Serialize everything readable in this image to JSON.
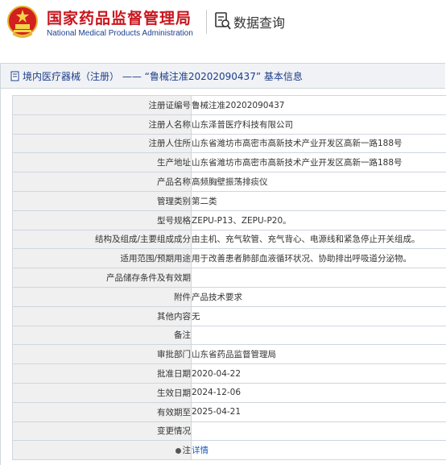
{
  "header": {
    "brand_cn": "国家药品监督管理局",
    "brand_en": "National Medical Products Administration",
    "page_title": "数据查询"
  },
  "panel": {
    "title": "境内医疗器械（注册） —— “鲁械注准20202090437” 基本信息"
  },
  "rows": [
    {
      "label": "注册证编号",
      "value": "鲁械注准20202090437"
    },
    {
      "label": "注册人名称",
      "value": "山东泽普医疗科技有限公司"
    },
    {
      "label": "注册人住所",
      "value": "山东省潍坊市高密市高新技术产业开发区高新一路188号"
    },
    {
      "label": "生产地址",
      "value": "山东省潍坊市高密市高新技术产业开发区高新一路188号"
    },
    {
      "label": "产品名称",
      "value": "高频胸壁振荡排痰仪"
    },
    {
      "label": "管理类别",
      "value": "第二类"
    },
    {
      "label": "型号规格",
      "value": "ZEPU-P13、ZEPU-P20。"
    },
    {
      "label": "结构及组成/主要组成成分",
      "value": "由主机、充气软管、充气背心、电源线和紧急停止开关组成。"
    },
    {
      "label": "适用范围/预期用途",
      "value": "用于改善患者肺部血液循环状况、协助排出呼吸道分泌物。"
    },
    {
      "label": "产品储存条件及有效期",
      "value": ""
    },
    {
      "label": "附件",
      "value": "产品技术要求"
    },
    {
      "label": "其他内容",
      "value": "无"
    },
    {
      "label": "备注",
      "value": ""
    },
    {
      "label": "审批部门",
      "value": "山东省药品监督管理局"
    },
    {
      "label": "批准日期",
      "value": "2020-04-22"
    },
    {
      "label": "生效日期",
      "value": "2024-12-06"
    },
    {
      "label": "有效期至",
      "value": "2025-04-21"
    },
    {
      "label": "变更情况",
      "value": ""
    }
  ],
  "note": {
    "label": "注",
    "link": "详情"
  },
  "icons": {
    "emblem": "national-emblem-icon",
    "query": "data-query-icon",
    "doc": "document-icon"
  },
  "colors": {
    "brand_red": "#c8151d",
    "brand_blue": "#1c3f8f",
    "link": "#1d5fb8"
  }
}
